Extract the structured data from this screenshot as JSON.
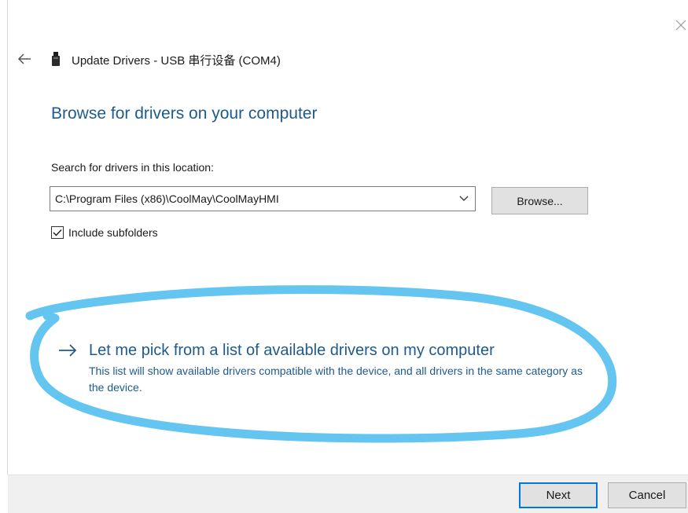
{
  "window": {
    "title": "Update Drivers - USB 串行设备 (COM4)"
  },
  "page": {
    "heading": "Browse for drivers on your computer",
    "search_label": "Search for drivers in this location:",
    "path_value": "C:\\Program Files (x86)\\CoolMay\\CoolMayHMI",
    "browse_label": "Browse...",
    "include_subfolders_label": "Include subfolders",
    "include_subfolders_checked": true
  },
  "pick": {
    "title": "Let me pick from a list of available drivers on my computer",
    "description": "This list will show available drivers compatible with the device, and all drivers in the same category as the device."
  },
  "footer": {
    "next_label": "Next",
    "cancel_label": "Cancel"
  },
  "icons": {
    "back": "back-arrow-icon",
    "close": "close-icon",
    "device": "usb-device-icon",
    "dropdown": "chevron-down-icon",
    "check": "checkmark-icon",
    "link_arrow": "right-arrow-icon"
  },
  "colors": {
    "heading": "#1f5a8c",
    "link": "#1f5a8c",
    "annotation": "#5bc2ef",
    "default_button_border": "#0078d7",
    "footer_bg": "#f0f0f0"
  }
}
